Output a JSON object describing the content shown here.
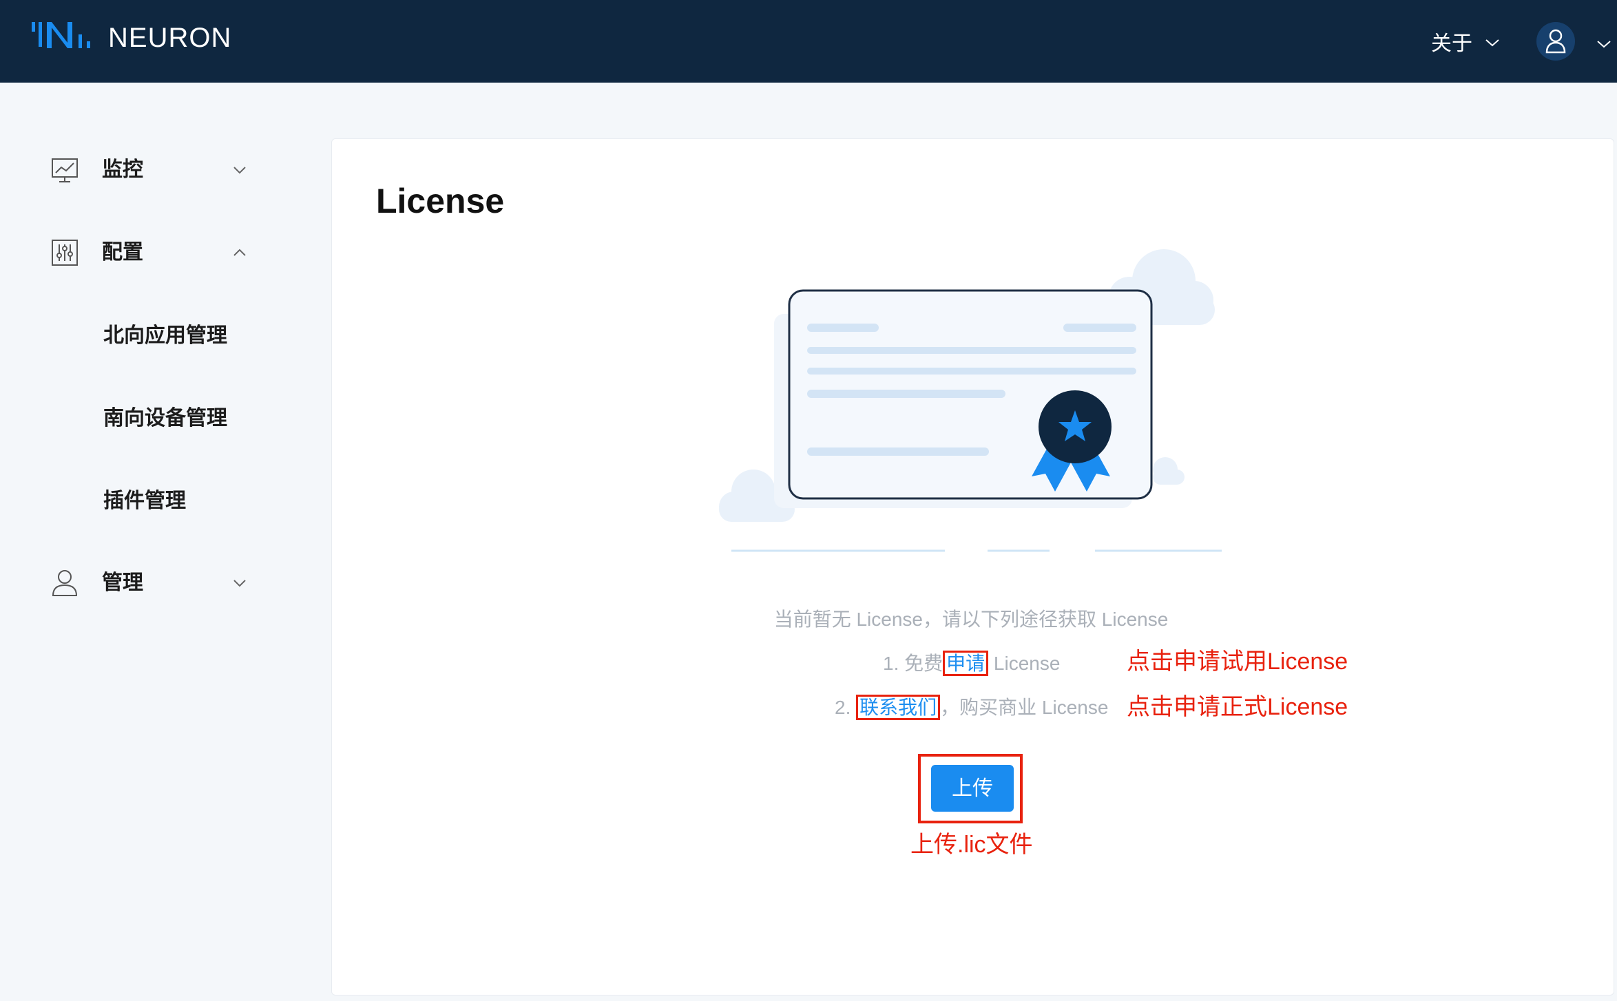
{
  "header": {
    "brand": "NEURON",
    "about_label": "关于"
  },
  "sidebar": {
    "items": [
      {
        "label": "监控",
        "icon": "monitor-icon",
        "expanded": false
      },
      {
        "label": "配置",
        "icon": "config-icon",
        "expanded": true,
        "children": [
          "北向应用管理",
          "南向设备管理",
          "插件管理"
        ]
      },
      {
        "label": "管理",
        "icon": "user-icon",
        "expanded": false
      }
    ]
  },
  "main": {
    "title": "License",
    "description": "当前暂无 License，请以下列途径获取 License",
    "step1": {
      "prefix": "1. 免费",
      "link": "申请",
      "suffix": " License"
    },
    "step2": {
      "prefix": "2. ",
      "link": "联系我们",
      "suffix": "，购买商业 License"
    },
    "upload_label": "上传"
  },
  "annotations": {
    "apply_trial": "点击申请试用License",
    "apply_formal": "点击申请正式License",
    "upload_file": "上传.lic文件"
  },
  "colors": {
    "header_bg": "#0f2740",
    "accent": "#1a8cf0",
    "annotation_red": "#e8220e",
    "page_bg": "#f4f7fa"
  }
}
